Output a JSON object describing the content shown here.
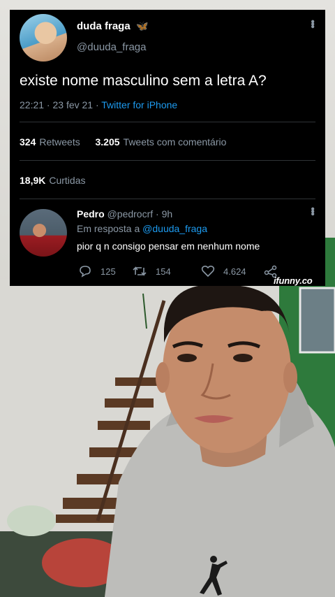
{
  "tweet": {
    "display_name": "duda fraga",
    "emoji": "🦋",
    "handle": "@duuda_fraga",
    "text": "existe nome masculino sem a letra A?",
    "time": "22:21 · 23 fev 21 · ",
    "source": "Twitter for iPhone",
    "retweets_count": "324",
    "retweets_label": "Retweets",
    "quotes_count": "3.205",
    "quotes_label": "Tweets com comentário",
    "likes_count": "18,9K",
    "likes_label": "Curtidas"
  },
  "reply": {
    "display_name": "Pedro",
    "handle_time": "@pedrocrf · 9h",
    "reply_prefix": "Em resposta a ",
    "reply_to": "@duuda_fraga",
    "text": "pior q n consigo pensar em nenhum nome",
    "reply_count": "125",
    "retweet_count": "154",
    "like_count": "4.624"
  },
  "watermark": "ifunny.co",
  "colors": {
    "card_bg": "#000000",
    "link": "#1d9bf0",
    "muted": "#8b98a5",
    "wall_green": "#2f7a3a",
    "hoodie_gray": "#b9b9b6"
  },
  "icons": [
    "butterfly-icon",
    "more-options-icon",
    "reply-icon",
    "retweet-icon",
    "like-icon",
    "share-icon",
    "jumpman-logo"
  ]
}
